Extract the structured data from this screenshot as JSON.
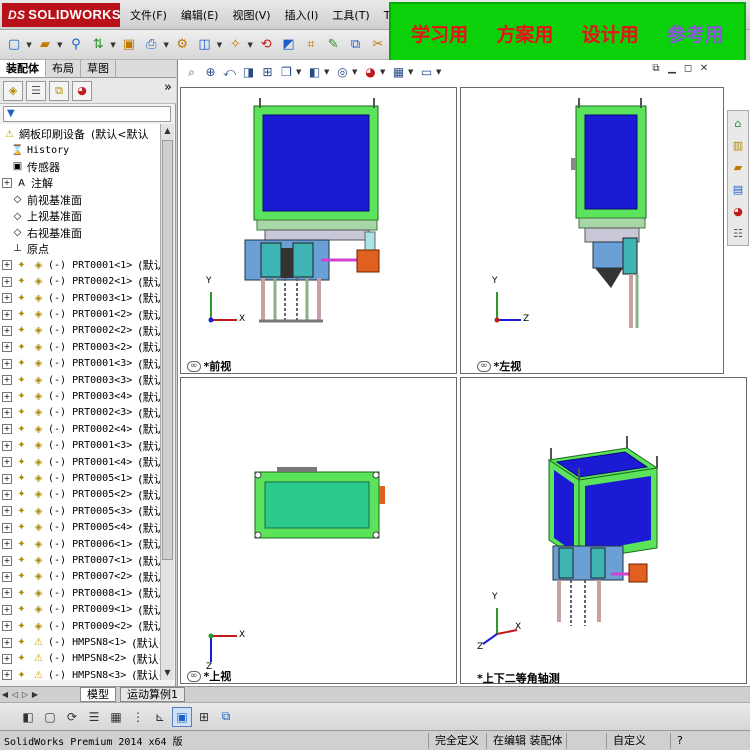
{
  "app": {
    "brand": "SOLIDWORKS",
    "brand_prefix": "DS",
    "menu": [
      "文件(F)",
      "编辑(E)",
      "视图(V)",
      "插入(I)",
      "工具(T)",
      "Toolb"
    ],
    "watermark": [
      "学习用",
      "方案用",
      "设计用",
      "参考用"
    ]
  },
  "left_panel": {
    "tabs": [
      "装配体",
      "布局",
      "草图"
    ],
    "active_tab": "装配体",
    "filter_symbol": "▼",
    "tree": [
      {
        "label": "網板印刷设备",
        "suffix": "(默认<默认",
        "type": "assembly"
      },
      {
        "label": "History",
        "type": "history"
      },
      {
        "label": "传感器",
        "type": "sensor"
      },
      {
        "label": "注解",
        "type": "annotation"
      },
      {
        "label": "前视基准面",
        "type": "plane"
      },
      {
        "label": "上视基准面",
        "type": "plane"
      },
      {
        "label": "右视基准面",
        "type": "plane"
      },
      {
        "label": "原点",
        "type": "origin"
      },
      {
        "label": "(-) PRT0001<1>",
        "suffix": "(默认<<默",
        "type": "part"
      },
      {
        "label": "(-) PRT0002<1>",
        "suffix": "(默认<<默",
        "type": "part"
      },
      {
        "label": "(-) PRT0003<1>",
        "suffix": "(默认<<默",
        "type": "part"
      },
      {
        "label": "(-) PRT0001<2>",
        "suffix": "(默认<<默",
        "type": "part"
      },
      {
        "label": "(-) PRT0002<2>",
        "suffix": "(默认<<默",
        "type": "part"
      },
      {
        "label": "(-) PRT0003<2>",
        "suffix": "(默认<<默",
        "type": "part"
      },
      {
        "label": "(-) PRT0001<3>",
        "suffix": "(默认<<默",
        "type": "part"
      },
      {
        "label": "(-) PRT0003<3>",
        "suffix": "(默认<<默",
        "type": "part"
      },
      {
        "label": "(-) PRT0003<4>",
        "suffix": "(默认<<默",
        "type": "part"
      },
      {
        "label": "(-) PRT0002<3>",
        "suffix": "(默认<<默",
        "type": "part"
      },
      {
        "label": "(-) PRT0002<4>",
        "suffix": "(默认<<默",
        "type": "part"
      },
      {
        "label": "(-) PRT0001<3>",
        "suffix": "(默认<<默",
        "type": "part"
      },
      {
        "label": "(-) PRT0001<4>",
        "suffix": "(默认<<默",
        "type": "part"
      },
      {
        "label": "(-) PRT0005<1>",
        "suffix": "(默认<<默",
        "type": "part"
      },
      {
        "label": "(-) PRT0005<2>",
        "suffix": "(默认<<默",
        "type": "part"
      },
      {
        "label": "(-) PRT0005<3>",
        "suffix": "(默认<<默",
        "type": "part"
      },
      {
        "label": "(-) PRT0005<4>",
        "suffix": "(默认<<默",
        "type": "part"
      },
      {
        "label": "(-) PRT0006<1>",
        "suffix": "(默认<<默",
        "type": "part"
      },
      {
        "label": "(-) PRT0007<1>",
        "suffix": "(默认<<默",
        "type": "part"
      },
      {
        "label": "(-) PRT0007<2>",
        "suffix": "(默认<<默",
        "type": "part"
      },
      {
        "label": "(-) PRT0008<1>",
        "suffix": "(默认<<默",
        "type": "part"
      },
      {
        "label": "(-) PRT0009<1>",
        "suffix": "(默认<<默",
        "type": "part"
      },
      {
        "label": "(-) PRT0009<2>",
        "suffix": "(默认<<默",
        "type": "part"
      },
      {
        "label": "(-) HMPSN8<1>",
        "suffix": "(默认<",
        "type": "warnpart"
      },
      {
        "label": "(-) HMPSN8<2>",
        "suffix": "(默认<",
        "type": "warnpart"
      },
      {
        "label": "(-) HMPSN8<3>",
        "suffix": "(默认<",
        "type": "warnpart"
      }
    ]
  },
  "viewports": {
    "front": "*前视",
    "left": "*左视",
    "top": "*上视",
    "iso": "*上下二等角轴测"
  },
  "axes": {
    "x": "X",
    "y": "Y",
    "z": "Z"
  },
  "bottom_tabs": [
    "模型",
    "运动算例1"
  ],
  "active_bottom_tab": "模型",
  "status": {
    "product": "SolidWorks Premium 2014 x64 版",
    "constraint": "完全定义",
    "editing": "在编辑 装配体",
    "custom": "自定义"
  },
  "colors": {
    "frame_green": "#5be35b",
    "panel_blue": "#1b1bd6",
    "title_red": "#b8111a",
    "watermark_green": "#0bd10b",
    "watermark_red": "#e8121b",
    "watermark_purple": "#8a57d8"
  }
}
